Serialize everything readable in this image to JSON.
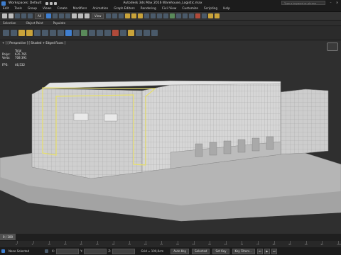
{
  "app": {
    "workspace": "Workspaces: Default",
    "title": "Autodesk 3ds Max 2016   Warehouse_Logistic.max",
    "search_placeholder": "Type a keyword or phrase"
  },
  "menu": [
    "Edit",
    "Tools",
    "Group",
    "Views",
    "Create",
    "Modifiers",
    "Animation",
    "Graph Editors",
    "Rendering",
    "Civil View",
    "Customize",
    "Scripting",
    "Help"
  ],
  "toolbar": {
    "filter": "All",
    "view": "View"
  },
  "ribbon": [
    "Selection",
    "Object Paint",
    "Populate"
  ],
  "viewport": {
    "label": "+ ] [ Perspective ] [ Shaded + Edged Faces ]",
    "stats": [
      {
        "k": "",
        "v": "Total"
      },
      {
        "k": "Polys:",
        "v": "635 765"
      },
      {
        "k": "Verts:",
        "v": "708 391"
      },
      {
        "k": "FPS:",
        "v": "46,532"
      }
    ],
    "accent": "#e8e06a"
  },
  "timeline": {
    "counter": "0 / 100",
    "ticks": [
      "0",
      "5",
      "10",
      "15",
      "20",
      "25",
      "30",
      "35",
      "40",
      "45",
      "50",
      "55",
      "60",
      "65",
      "70",
      "75",
      "80",
      "85",
      "90",
      "95",
      "100"
    ]
  },
  "status": {
    "selected": "None Selected",
    "x_label": "X:",
    "y_label": "Y:",
    "z_label": "Z:",
    "grid": "Grid = 100,0cm",
    "autokey": "Auto Key",
    "selected_mode": "Selected",
    "setkey": "Set Key",
    "keyfilters": "Key Filters..."
  }
}
